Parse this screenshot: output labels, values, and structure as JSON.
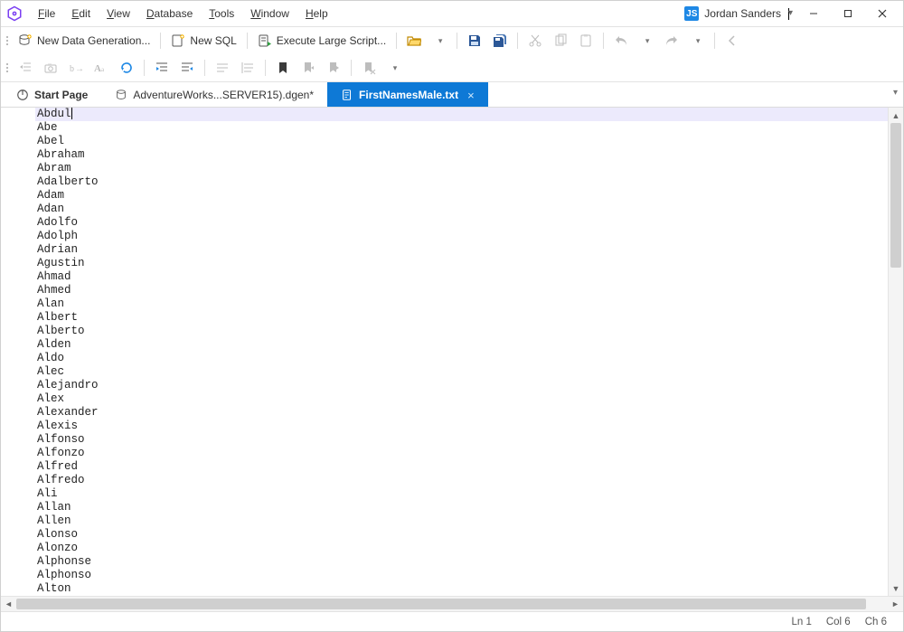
{
  "menu": {
    "items": [
      {
        "u": "F",
        "rest": "ile"
      },
      {
        "u": "E",
        "rest": "dit"
      },
      {
        "u": "V",
        "rest": "iew"
      },
      {
        "u": "D",
        "rest": "atabase"
      },
      {
        "u": "T",
        "rest": "ools"
      },
      {
        "u": "W",
        "rest": "indow"
      },
      {
        "u": "H",
        "rest": "elp"
      }
    ]
  },
  "user": {
    "badge": "JS",
    "name": "Jordan Sanders"
  },
  "toolbar1": {
    "new_data_gen": "New Data Generation...",
    "new_sql": "New SQL",
    "exec_large": "Execute Large Script..."
  },
  "tabs": {
    "0": {
      "label": "Start Page"
    },
    "1": {
      "label": "AdventureWorks...SERVER15).dgen*"
    },
    "2": {
      "label": "FirstNamesMale.txt"
    }
  },
  "editor": {
    "lines": [
      "Abdul",
      "Abe",
      "Abel",
      "Abraham",
      "Abram",
      "Adalberto",
      "Adam",
      "Adan",
      "Adolfo",
      "Adolph",
      "Adrian",
      "Agustin",
      "Ahmad",
      "Ahmed",
      "Alan",
      "Albert",
      "Alberto",
      "Alden",
      "Aldo",
      "Alec",
      "Alejandro",
      "Alex",
      "Alexander",
      "Alexis",
      "Alfonso",
      "Alfonzo",
      "Alfred",
      "Alfredo",
      "Ali",
      "Allan",
      "Allen",
      "Alonso",
      "Alonzo",
      "Alphonse",
      "Alphonso",
      "Alton"
    ]
  },
  "status": {
    "ln": "Ln 1",
    "col": "Col 6",
    "ch": "Ch 6"
  }
}
